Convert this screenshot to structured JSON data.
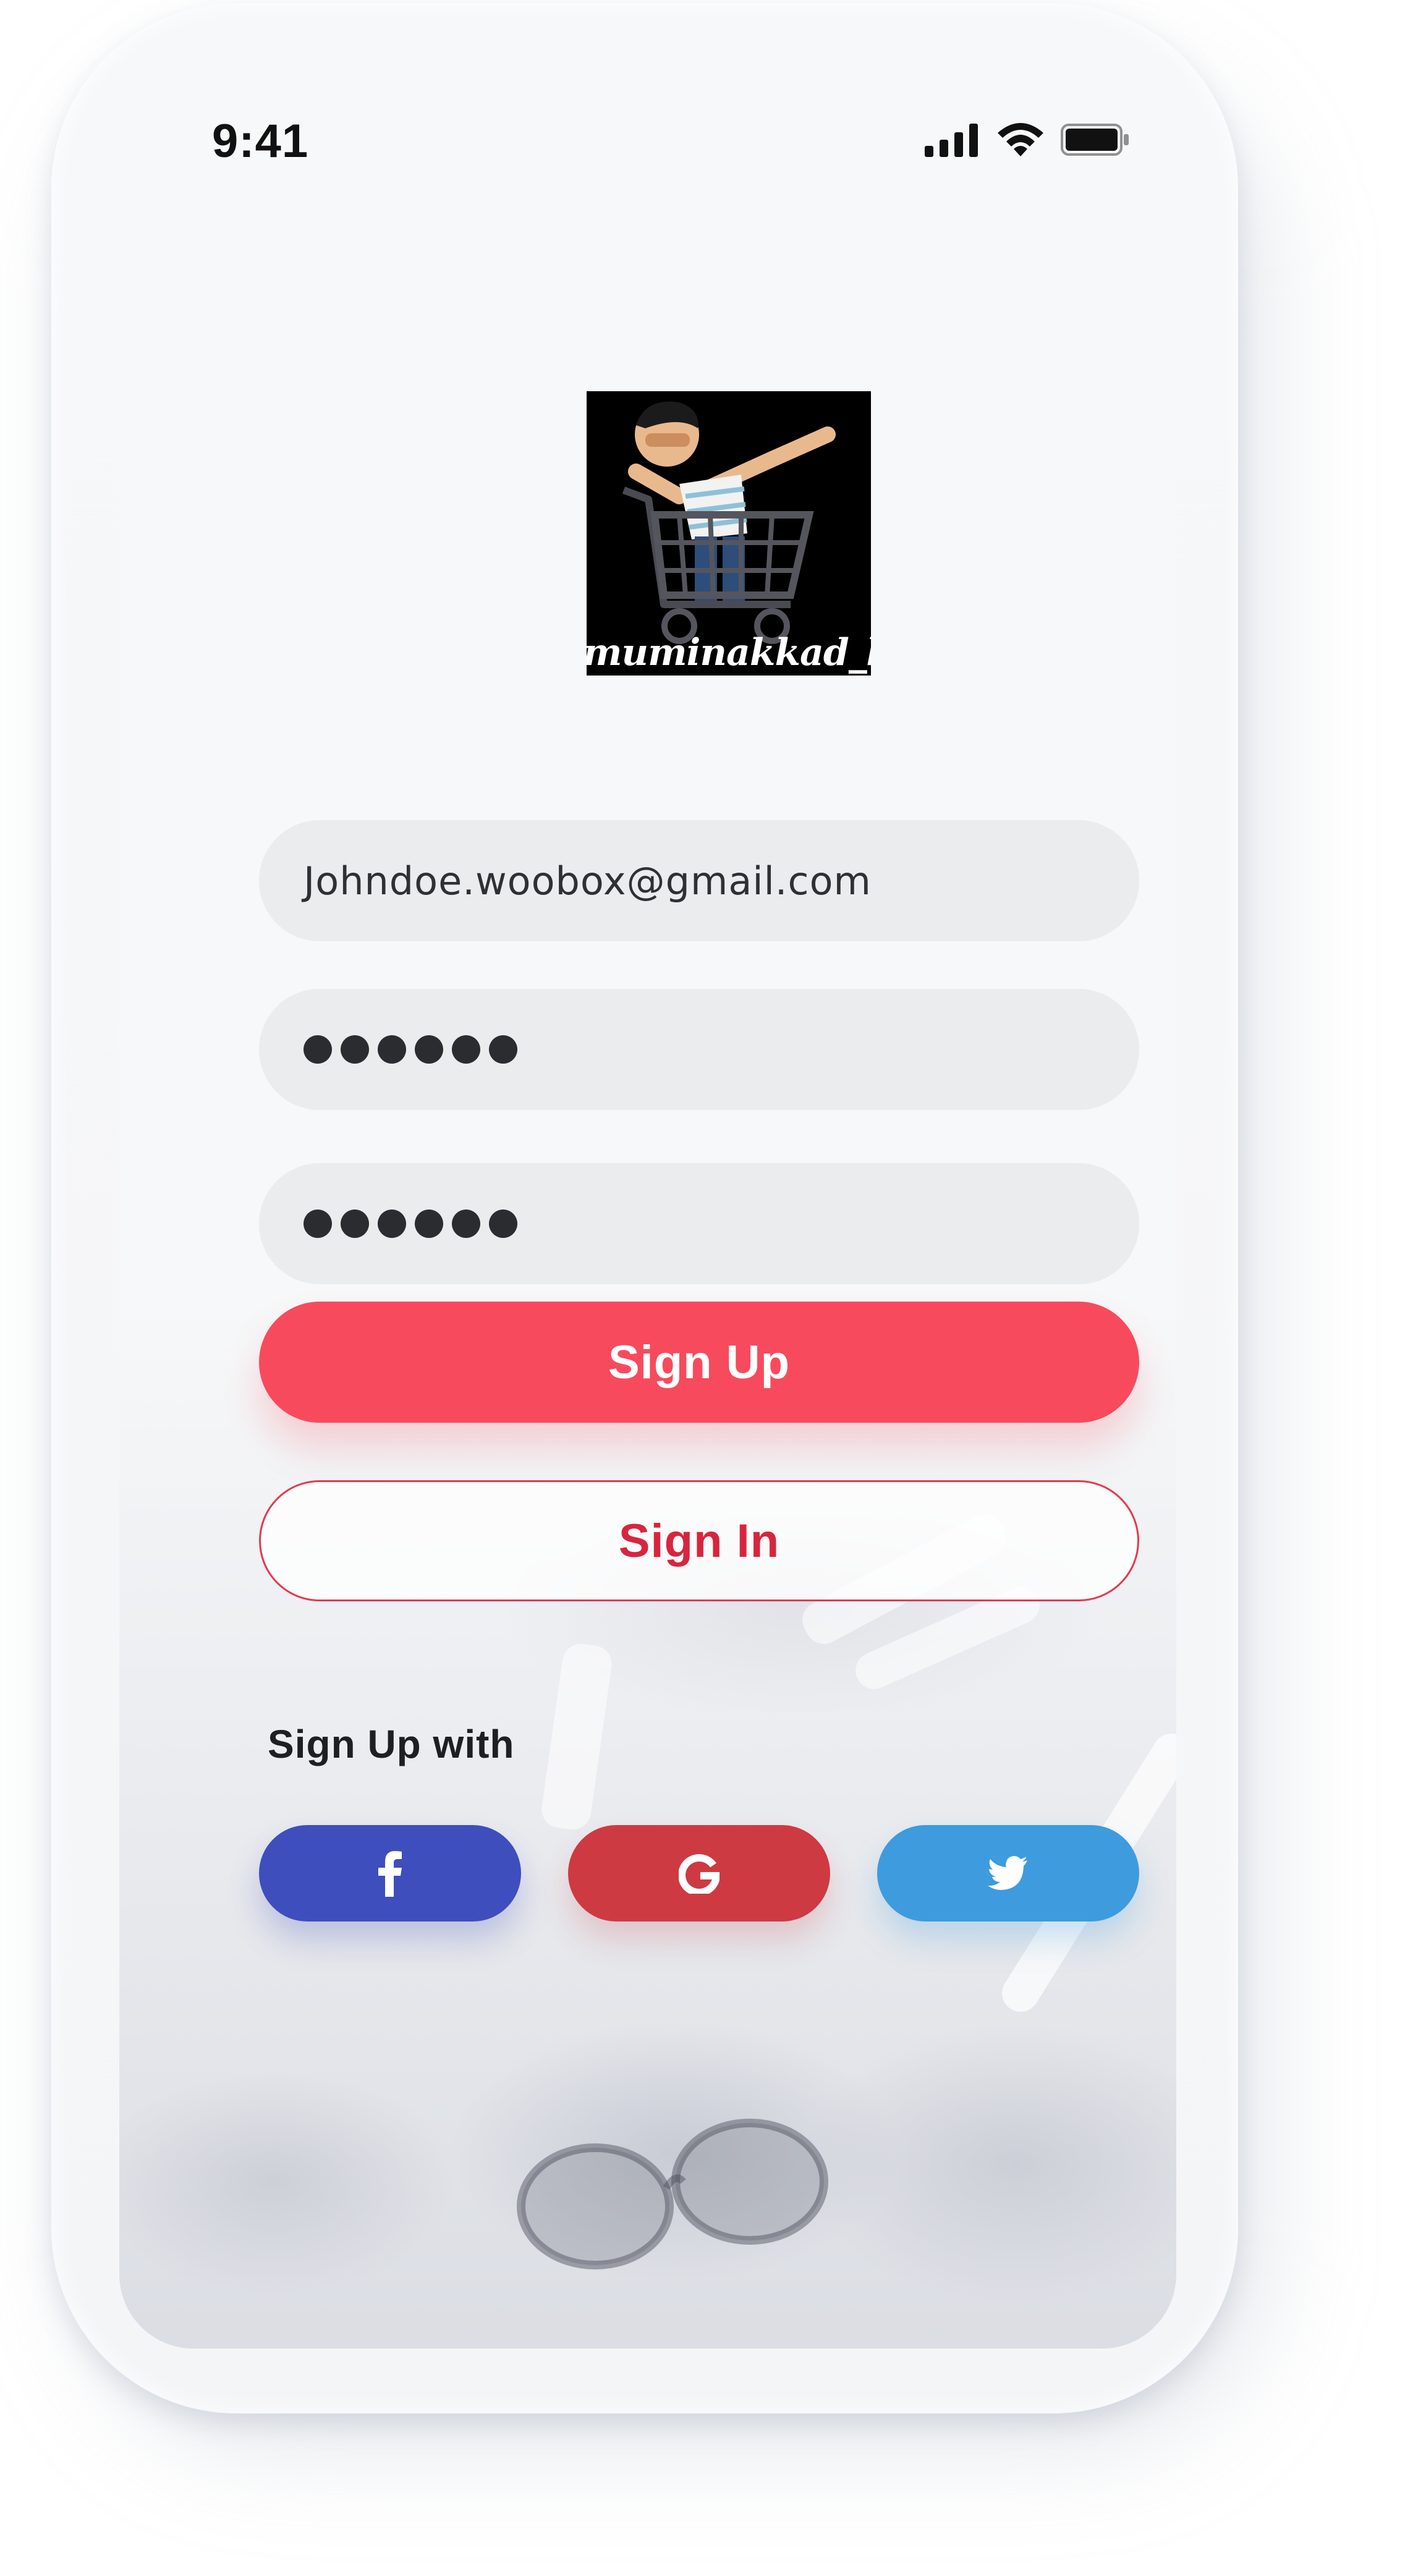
{
  "status_bar": {
    "time": "9:41",
    "icons": [
      "cellular-signal-icon",
      "wifi-icon",
      "battery-icon"
    ]
  },
  "logo": {
    "caption": "muminakkad_bar",
    "icon": "dabbing-man-in-shopping-cart-icon"
  },
  "form": {
    "email": {
      "value": "Johndoe.woobox@gmail.com"
    },
    "password": {
      "masked_length": 6
    },
    "confirm_password": {
      "masked_length": 6
    }
  },
  "buttons": {
    "sign_up_label": "Sign Up",
    "sign_in_label": "Sign In"
  },
  "social": {
    "heading": "Sign Up with",
    "providers": [
      {
        "name": "facebook",
        "icon": "facebook-icon",
        "color": "#3e4ebc"
      },
      {
        "name": "google",
        "icon": "google-icon",
        "color": "#cd3a42"
      },
      {
        "name": "twitter",
        "icon": "twitter-icon",
        "color": "#3e9bde"
      }
    ]
  },
  "colors": {
    "accent": "#f84a5d",
    "accent_outline": "#d8253e",
    "field_bg": "#ebeced"
  }
}
